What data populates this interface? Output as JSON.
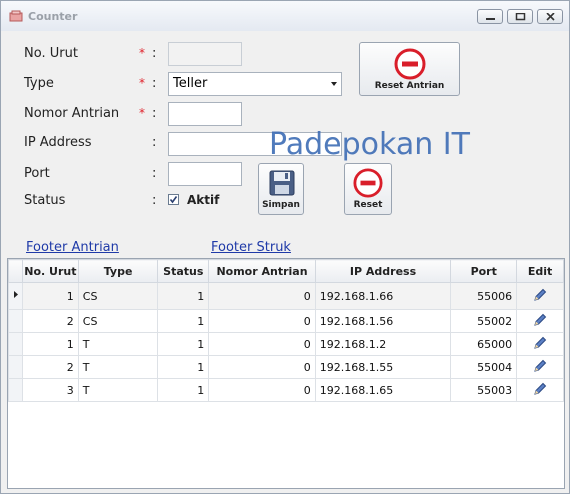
{
  "window": {
    "title": "Counter"
  },
  "form": {
    "no_urut": {
      "label": "No. Urut",
      "value": ""
    },
    "type": {
      "label": "Type",
      "value": "Teller"
    },
    "nomor_antrian": {
      "label": "Nomor Antrian",
      "value": ""
    },
    "ip_address": {
      "label": "IP Address",
      "value": ""
    },
    "port": {
      "label": "Port",
      "value": ""
    },
    "status": {
      "label": "Status",
      "checkbox_label": "Aktif",
      "checked": true
    },
    "required_mark": "*",
    "colon": ":"
  },
  "buttons": {
    "reset_antrian": "Reset Antrian",
    "simpan": "Simpan",
    "reset": "Reset"
  },
  "watermark": "Padepokan IT",
  "links": {
    "footer_antrian": "Footer Antrian",
    "footer_struk": "Footer Struk"
  },
  "table": {
    "headers": [
      "No. Urut",
      "Type",
      "Status",
      "Nomor Antrian",
      "IP Address",
      "Port",
      "Edit"
    ],
    "rows": [
      {
        "no_urut": "1",
        "type": "CS",
        "status": "1",
        "nomor_antrian": "0",
        "ip": "192.168.1.66",
        "port": "55006"
      },
      {
        "no_urut": "2",
        "type": "CS",
        "status": "1",
        "nomor_antrian": "0",
        "ip": "192.168.1.56",
        "port": "55002"
      },
      {
        "no_urut": "1",
        "type": "T",
        "status": "1",
        "nomor_antrian": "0",
        "ip": "192.168.1.2",
        "port": "65000"
      },
      {
        "no_urut": "2",
        "type": "T",
        "status": "1",
        "nomor_antrian": "0",
        "ip": "192.168.1.55",
        "port": "55004"
      },
      {
        "no_urut": "3",
        "type": "T",
        "status": "1",
        "nomor_antrian": "0",
        "ip": "192.168.1.65",
        "port": "55003"
      }
    ]
  },
  "colors": {
    "accent_red": "#d91e2a",
    "link_blue": "#1f3aa8",
    "watermark_blue": "#3e6db5"
  }
}
